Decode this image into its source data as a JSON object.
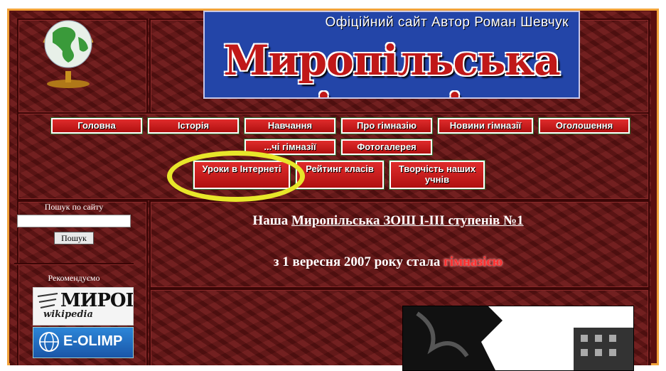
{
  "header": {
    "banner_top": "Офіційний сайт  Автор Роман Шевчук",
    "banner_title": "Миропільська гімназія"
  },
  "nav": {
    "row1": [
      "Головна",
      "Історія",
      "Навчання",
      "Про гімназію",
      "Новини гімназії",
      "Оголошення"
    ],
    "row2": [
      "...чі гімназії",
      "Фотогалерея"
    ],
    "row3": [
      "Уроки в Інтернеті",
      "Рейтинг класів",
      "Творчість наших учнів"
    ],
    "highlighted": "Уроки в Інтернеті"
  },
  "sidebar": {
    "search_label": "Пошук по сайту",
    "search_value": "",
    "search_button": "Пошук",
    "recommend_label": "Рекомендуємо",
    "logo_wiki_big": "МИРОПІЛЬ",
    "logo_wiki_small": "wikipedia",
    "logo_olimp": "E-OLIMP"
  },
  "main": {
    "line1_prefix": "Наша ",
    "line1_link": "Миропільська ЗОШ І-ІІІ ступенів №1",
    "line2_prefix": "з 1 вересня 2007 року стала ",
    "line2_highlight": "гімназією"
  },
  "colors": {
    "frame": "#f2a33a",
    "page_bg": "#6b1414",
    "button_red": "#c41a1a",
    "banner_blue": "#2345a8",
    "highlight_ring": "#e8e62a"
  }
}
